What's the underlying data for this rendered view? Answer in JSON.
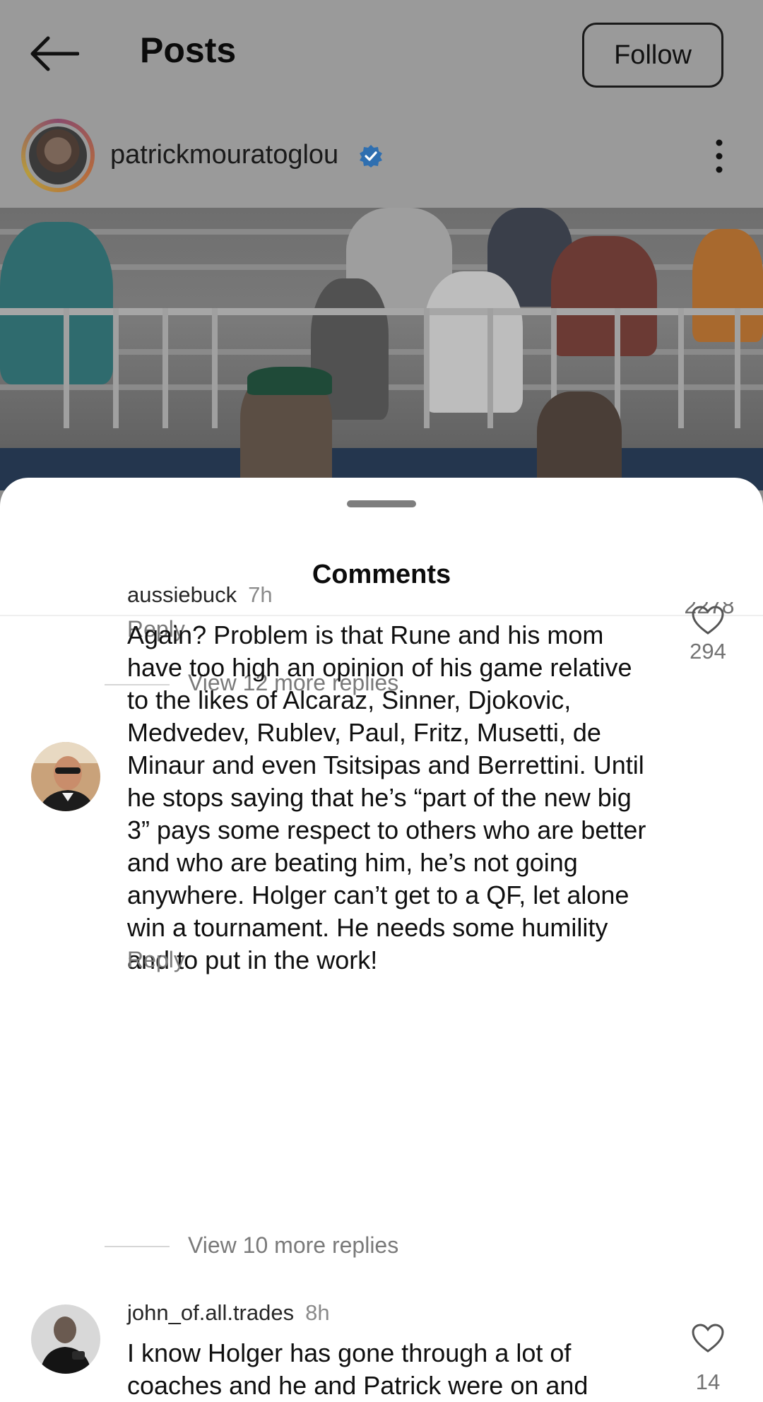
{
  "header": {
    "title": "Posts",
    "back_icon": "arrow-left-icon",
    "follow_label": "Follow"
  },
  "profile": {
    "username": "patrickmouratoglou",
    "verified_icon": "verified-badge-icon",
    "more_icon": "more-vertical-icon"
  },
  "comments_sheet": {
    "title": "Comments",
    "previous_thread": {
      "reply_label": "Reply",
      "likes_partial": "2278",
      "view_more": "View 12 more replies"
    },
    "comments": [
      {
        "username": "aussiebuck",
        "time": "7h",
        "text": "Again? Problem is that Rune and his mom have too high an opinion of his game relative to the likes of Alcaraz, Sinner, Djokovic, Medvedev, Rublev, Paul, Fritz, Musetti, de Minaur and even Tsitsipas and Berrettini. Until he stops saying that he’s “part of the new big 3” pays some respect to others who are better and who are beating him, he’s not going anywhere. Holger can’t get to a QF, let  alone win a tournament. He needs some humility and to put in the work!",
        "likes": "294",
        "reply_label": "Reply",
        "view_more": "View 10 more replies"
      },
      {
        "username": "john_of.all.trades",
        "time": "8h",
        "text": "I know Holger has gone through a lot of coaches and he and Patrick were on and",
        "likes": "14"
      }
    ]
  },
  "colors": {
    "overlay_dim": "#8c8c8c",
    "sheet_bg": "#ffffff",
    "secondary_text": "#7a7a7a",
    "verified_blue": "#3797f0"
  }
}
